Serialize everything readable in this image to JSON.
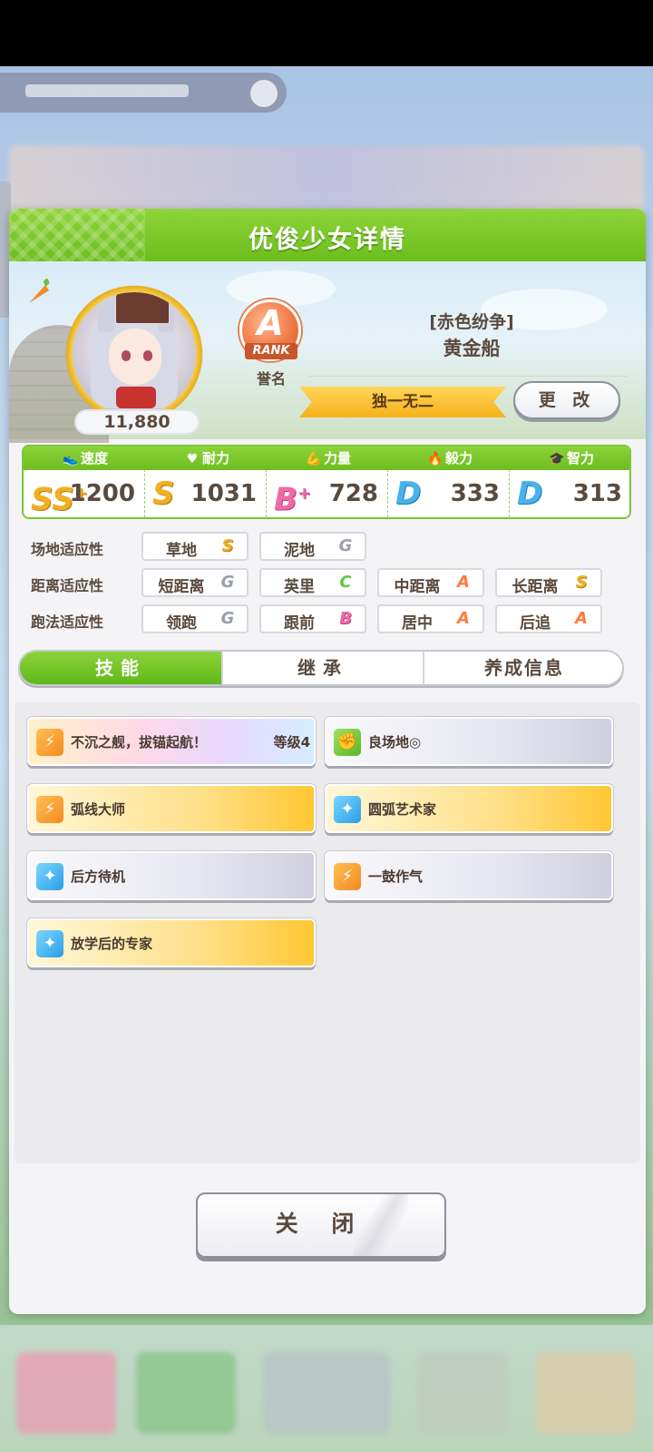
{
  "dialog": {
    "title": "优俊少女详情",
    "fan_count": "11,880",
    "rank": {
      "letter": "A",
      "label": "RANK",
      "caption": "誉名"
    },
    "character": {
      "title": "[赤色纷争]",
      "name": "黄金船"
    },
    "epithet": "独一无二",
    "change_button": "更 改",
    "close_button": "关 闭"
  },
  "stats": [
    {
      "label": "速度",
      "icon": "shoe-icon",
      "icon_glyph": "👟",
      "grade": "SS",
      "grade_sup": "+",
      "value": "1200"
    },
    {
      "label": "耐力",
      "icon": "heart-icon",
      "icon_glyph": "♥",
      "grade": "S",
      "grade_sup": "",
      "value": "1031"
    },
    {
      "label": "力量",
      "icon": "muscle-icon",
      "icon_glyph": "💪",
      "grade": "B",
      "grade_sup": "+",
      "value": "728"
    },
    {
      "label": "毅力",
      "icon": "flame-icon",
      "icon_glyph": "🔥",
      "grade": "D",
      "grade_sup": "",
      "value": "333"
    },
    {
      "label": "智力",
      "icon": "grad-cap-icon",
      "icon_glyph": "🎓",
      "grade": "D",
      "grade_sup": "",
      "value": "313"
    }
  ],
  "aptitude": {
    "track": {
      "label": "场地适应性",
      "items": [
        {
          "name": "草地",
          "grade": "S"
        },
        {
          "name": "泥地",
          "grade": "G"
        }
      ]
    },
    "distance": {
      "label": "距离适应性",
      "items": [
        {
          "name": "短距离",
          "grade": "G"
        },
        {
          "name": "英里",
          "grade": "C"
        },
        {
          "name": "中距离",
          "grade": "A"
        },
        {
          "name": "长距离",
          "grade": "S"
        }
      ]
    },
    "style": {
      "label": "跑法适应性",
      "items": [
        {
          "name": "领跑",
          "grade": "G"
        },
        {
          "name": "跟前",
          "grade": "B"
        },
        {
          "name": "居中",
          "grade": "A"
        },
        {
          "name": "后追",
          "grade": "A"
        }
      ]
    }
  },
  "tabs": [
    {
      "label": "技能",
      "active": true
    },
    {
      "label": "继承",
      "active": false
    },
    {
      "label": "养成信息",
      "active": false
    }
  ],
  "skills": [
    {
      "name": "不沉之舰，拔锚起航！",
      "level": "等级4",
      "style": "rainbow",
      "icon": "running-icon",
      "icon_color": "orange"
    },
    {
      "name": "良场地◎",
      "level": "",
      "style": "white",
      "icon": "muscle-icon",
      "icon_color": "green"
    },
    {
      "name": "弧线大师",
      "level": "",
      "style": "gold",
      "icon": "running-icon",
      "icon_color": "orange"
    },
    {
      "name": "圆弧艺术家",
      "level": "",
      "style": "gold",
      "icon": "sparkle-icon",
      "icon_color": "blue"
    },
    {
      "name": "后方待机",
      "level": "",
      "style": "white",
      "icon": "sparkle-icon",
      "icon_color": "blue"
    },
    {
      "name": "一鼓作气",
      "level": "",
      "style": "white",
      "icon": "running-icon",
      "icon_color": "orange"
    },
    {
      "name": "放学后的专家",
      "level": "",
      "style": "gold",
      "icon": "sparkle-icon",
      "icon_color": "blue"
    }
  ],
  "colors": {
    "header_green": "#6dbd1d",
    "accent_gold": "#f6b01a",
    "text_brown": "#5a4a3e"
  }
}
